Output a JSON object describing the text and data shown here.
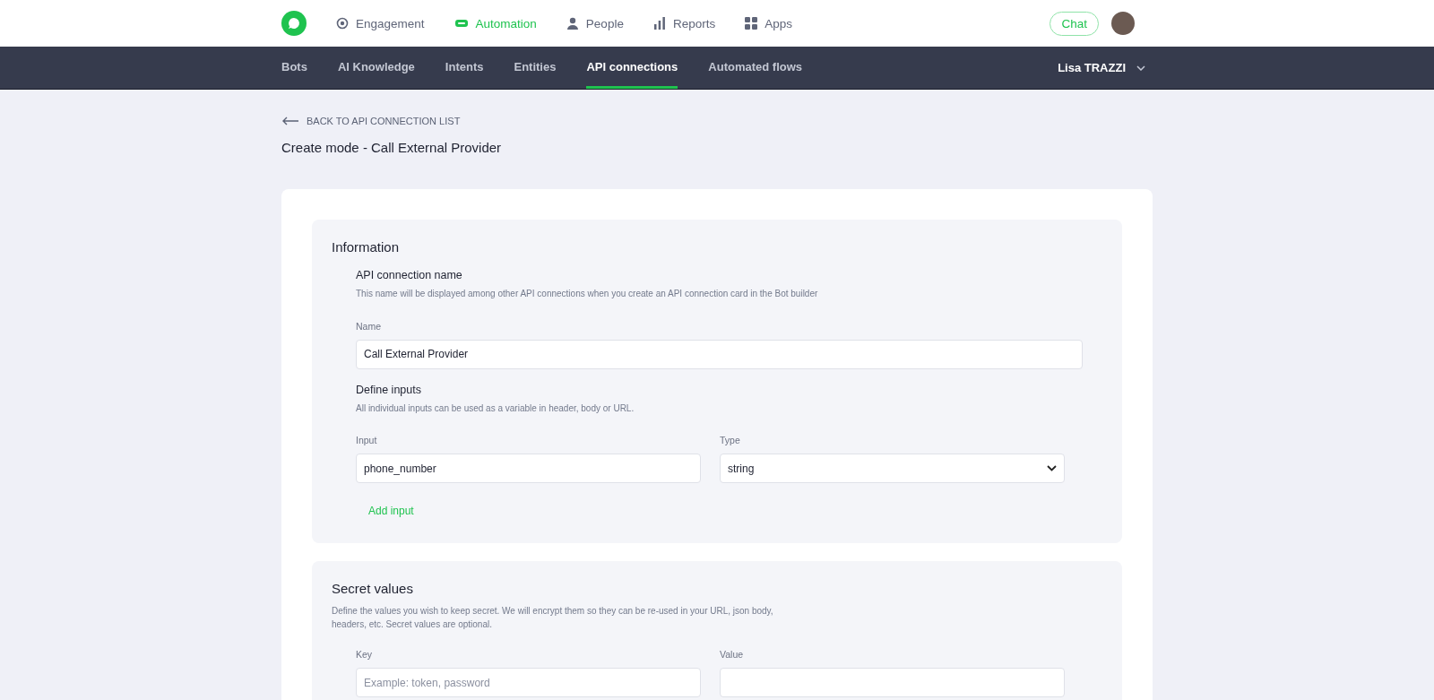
{
  "top_nav": {
    "items": [
      {
        "label": "Engagement",
        "kind": "engagement",
        "selected": false
      },
      {
        "label": "Automation",
        "kind": "automation",
        "selected": true
      },
      {
        "label": "People",
        "kind": "people",
        "selected": false
      },
      {
        "label": "Reports",
        "kind": "reports",
        "selected": false
      },
      {
        "label": "Apps",
        "kind": "apps",
        "selected": false
      }
    ],
    "chat_button": "Chat"
  },
  "sub_nav": {
    "items": [
      {
        "label": "Bots",
        "selected": false
      },
      {
        "label": "AI Knowledge",
        "selected": false
      },
      {
        "label": "Intents",
        "selected": false
      },
      {
        "label": "Entities",
        "selected": false
      },
      {
        "label": "API connections",
        "selected": true
      },
      {
        "label": "Automated flows",
        "selected": false
      }
    ],
    "user": "Lisa TRAZZI"
  },
  "back_link": "BACK TO API CONNECTION LIST",
  "page_title": "Create mode - Call External Provider",
  "information": {
    "title": "Information",
    "name_heading": "API connection name",
    "name_description": "This name will be displayed among other API connections when you create an API connection card in the Bot builder",
    "name_label": "Name",
    "name_value": "Call External Provider",
    "inputs_heading": "Define inputs",
    "inputs_description": "All individual inputs can be used as a variable in header, body or URL.",
    "input_label": "Input",
    "input_value": "phone_number",
    "type_label": "Type",
    "type_value": "string",
    "add_input": "Add input"
  },
  "secret_values": {
    "title": "Secret values",
    "description": "Define the values you wish to keep secret. We will encrypt them so they can be re-used in your URL, json body, headers, etc. Secret values are optional.",
    "key_label": "Key",
    "key_placeholder": "Example: token, password",
    "value_label": "Value"
  }
}
